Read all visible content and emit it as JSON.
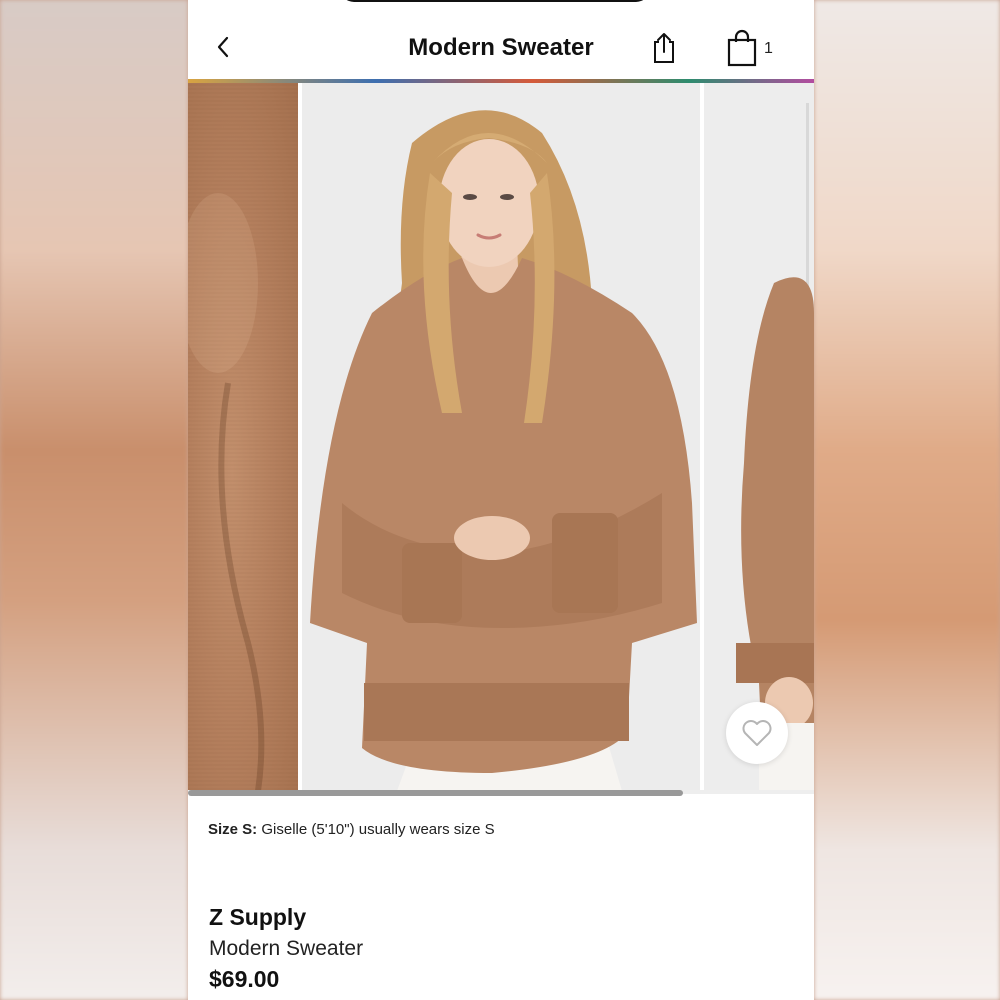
{
  "header": {
    "title": "Modern Sweater",
    "back_icon": "chevron-left-icon",
    "share_icon": "share-icon",
    "bag_icon": "shopping-bag-icon",
    "bag_count": "1"
  },
  "gallery": {
    "images": [
      "sweater-knit-closeup",
      "model-front-view",
      "model-side-view"
    ],
    "favorite_icon": "heart-icon",
    "scroll_progress": 0.79
  },
  "size_note": {
    "label": "Size S:",
    "text": "Giselle (5'10\") usually wears size S"
  },
  "product": {
    "brand": "Z Supply",
    "name": "Modern Sweater",
    "price": "$69.00"
  },
  "colors": {
    "sweater": "#b78564",
    "background": "#ffffff",
    "text": "#111111"
  }
}
